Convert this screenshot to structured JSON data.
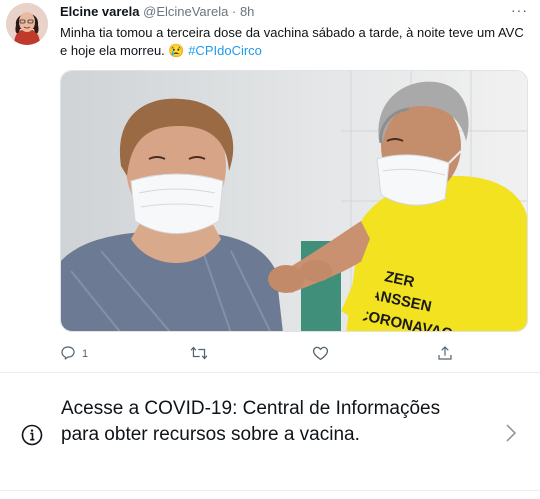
{
  "tweet": {
    "author_name": "Elcine varela",
    "author_handle": "@ElcineVarela",
    "separator": "·",
    "time": "8h",
    "more_label": "···",
    "text": "Minha tia tomou a terceira dose da vachina sábado a tarde, à noite teve um AVC e hoje ela morreu. 😢 ",
    "hashtag": "#CPIdoCirco",
    "image_shirt_text": [
      "PFIZER",
      "JANSSEN",
      "CORONAVAC"
    ],
    "actions": {
      "reply_count": "1",
      "retweet_count": "",
      "like_count": ""
    }
  },
  "notice": {
    "text": "Acesse a COVID-19: Central de Informações para obter recursos sobre a vacina."
  },
  "colors": {
    "accent": "#1d9bf0",
    "shirt": "#f3e21f",
    "text_secondary": "#536471"
  },
  "icons": [
    "avatar",
    "more-icon",
    "reply-icon",
    "retweet-icon",
    "like-icon",
    "share-icon",
    "info-icon",
    "chevron-right-icon"
  ]
}
